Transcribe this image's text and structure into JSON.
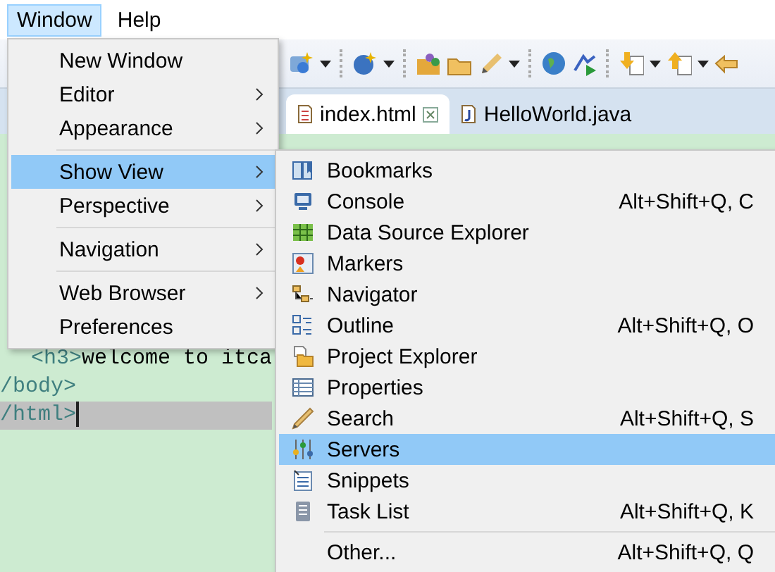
{
  "menubar": [
    {
      "label": "Window",
      "selected": true
    },
    {
      "label": "Help",
      "selected": false
    }
  ],
  "editor_tabs": [
    {
      "label": "index.html",
      "selected": true,
      "closable": true
    },
    {
      "label": "HelloWorld.java",
      "selected": false,
      "closable": false
    }
  ],
  "editor": {
    "lines": [
      {
        "current": false,
        "indent": true,
        "segments": [
          {
            "kind": "tag",
            "text": "<h3>"
          },
          {
            "kind": "text",
            "text": "welcome to itca"
          }
        ]
      },
      {
        "current": false,
        "indent": false,
        "segments": [
          {
            "kind": "tag",
            "text": "/body>"
          }
        ]
      },
      {
        "current": true,
        "indent": false,
        "segments": [
          {
            "kind": "tag",
            "text": "/html>"
          }
        ]
      }
    ]
  },
  "window_menu": {
    "items": [
      {
        "kind": "item",
        "label": "New Window",
        "submenu": false,
        "selected": false
      },
      {
        "kind": "item",
        "label": "Editor",
        "submenu": true,
        "selected": false
      },
      {
        "kind": "item",
        "label": "Appearance",
        "submenu": true,
        "selected": false
      },
      {
        "kind": "separator"
      },
      {
        "kind": "item",
        "label": "Show View",
        "submenu": true,
        "selected": true
      },
      {
        "kind": "item",
        "label": "Perspective",
        "submenu": true,
        "selected": false
      },
      {
        "kind": "separator"
      },
      {
        "kind": "item",
        "label": "Navigation",
        "submenu": true,
        "selected": false
      },
      {
        "kind": "separator"
      },
      {
        "kind": "item",
        "label": "Web Browser",
        "submenu": true,
        "selected": false
      },
      {
        "kind": "item",
        "label": "Preferences",
        "submenu": false,
        "selected": false
      }
    ]
  },
  "show_view_menu": {
    "items": [
      {
        "kind": "item",
        "label": "Bookmarks",
        "selected": false
      },
      {
        "kind": "item",
        "label": "Console",
        "shortcut": "Alt+Shift+Q, C",
        "selected": false
      },
      {
        "kind": "item",
        "label": "Data Source Explorer",
        "selected": false
      },
      {
        "kind": "item",
        "label": "Markers",
        "selected": false
      },
      {
        "kind": "item",
        "label": "Navigator",
        "selected": false
      },
      {
        "kind": "item",
        "label": "Outline",
        "shortcut": "Alt+Shift+Q, O",
        "selected": false
      },
      {
        "kind": "item",
        "label": "Project Explorer",
        "selected": false
      },
      {
        "kind": "item",
        "label": "Properties",
        "selected": false
      },
      {
        "kind": "item",
        "label": "Search",
        "shortcut": "Alt+Shift+Q, S",
        "selected": false
      },
      {
        "kind": "item",
        "label": "Servers",
        "selected": true
      },
      {
        "kind": "item",
        "label": "Snippets",
        "selected": false
      },
      {
        "kind": "item",
        "label": "Task List",
        "shortcut": "Alt+Shift+Q, K",
        "selected": false
      },
      {
        "kind": "separator"
      },
      {
        "kind": "item",
        "label": "Other...",
        "shortcut": "Alt+Shift+Q, Q",
        "selected": false
      }
    ]
  }
}
